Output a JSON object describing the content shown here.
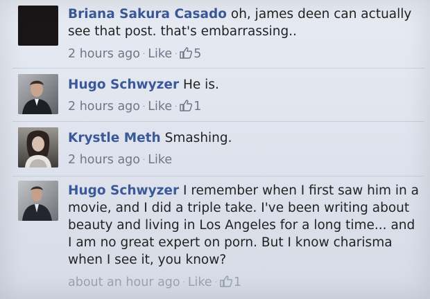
{
  "comments": [
    {
      "author": "Briana Sakura Casado",
      "text": "oh, james deen can actually see that post. that's embarrassing..",
      "time": "2 hours ago",
      "like_label": "Like",
      "like_count": "5",
      "avatar_icon": "user-avatar-dark"
    },
    {
      "author": "Hugo Schwyzer",
      "text": "He is.",
      "time": "2 hours ago",
      "like_label": "Like",
      "like_count": "1",
      "avatar_icon": "user-avatar-photo"
    },
    {
      "author": "Krystle Meth",
      "text": "Smashing.",
      "time": "2 hours ago",
      "like_label": "Like",
      "avatar_icon": "user-avatar-photo"
    },
    {
      "author": "Hugo Schwyzer",
      "text": "I remember when I first saw him in a movie, and I did a triple take. I've been writing about beauty and living in Los Angeles for a long time... and I am no great expert on porn. But I know charisma when I see it, you know?",
      "time": "about an hour ago",
      "like_label": "Like",
      "like_count": "1",
      "avatar_icon": "user-avatar-photo"
    }
  ],
  "colors": {
    "author_link": "#3b5998",
    "meta_text": "#6e7787",
    "background": "#e4e8f0"
  },
  "thumb_icon": "thumbs-up-icon",
  "separator": "·"
}
